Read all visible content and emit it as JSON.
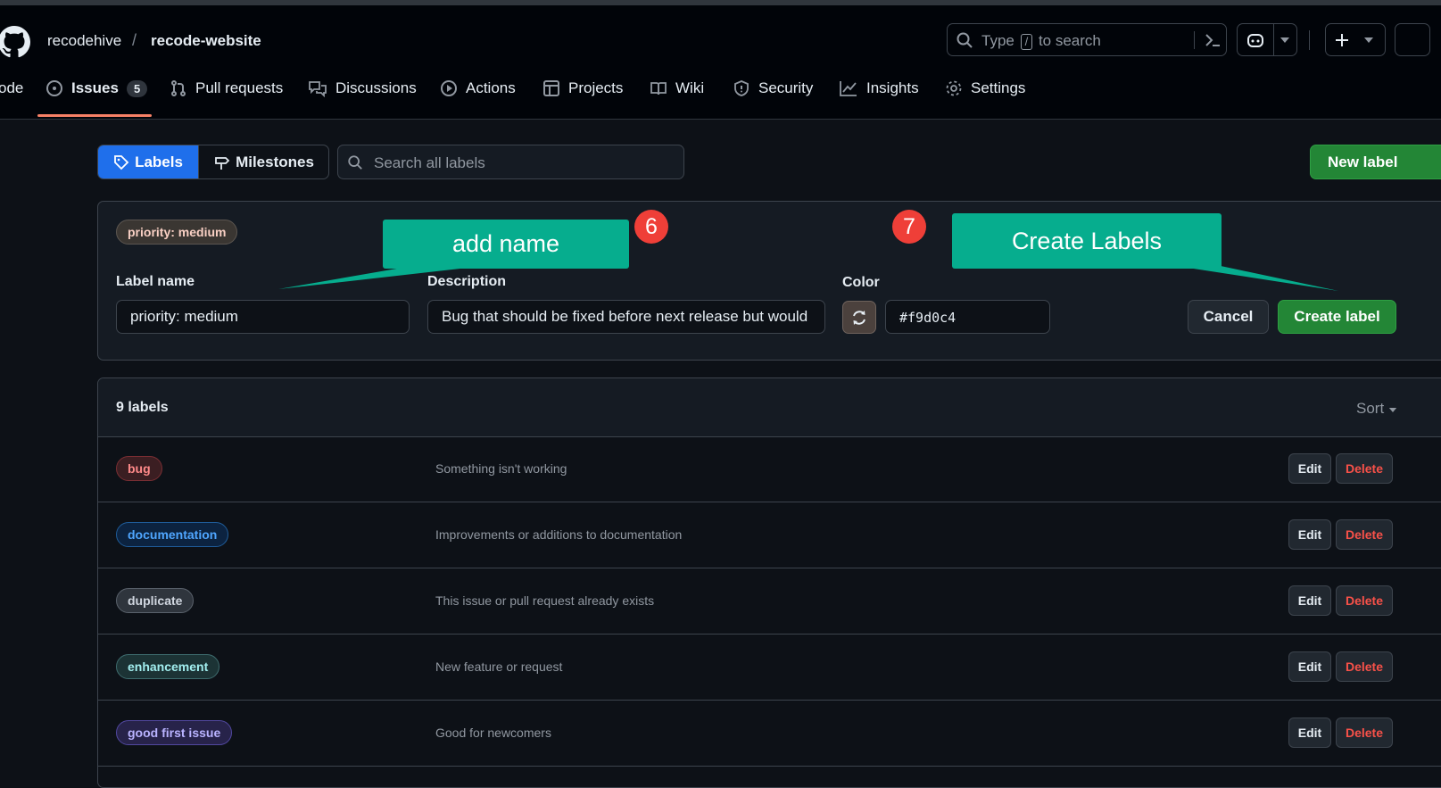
{
  "repo": {
    "owner": "recodehive",
    "slash": "/",
    "name": "recode-website"
  },
  "search": {
    "prefix": "Type",
    "key": "/",
    "suffix": "to search"
  },
  "tabs": [
    {
      "label": "ode",
      "icon": "code-icon"
    },
    {
      "label": "Issues",
      "icon": "issue-opened-icon",
      "count": "5",
      "active": true
    },
    {
      "label": "Pull requests",
      "icon": "git-pull-request-icon"
    },
    {
      "label": "Discussions",
      "icon": "comment-discussion-icon"
    },
    {
      "label": "Actions",
      "icon": "play-icon"
    },
    {
      "label": "Projects",
      "icon": "table-icon"
    },
    {
      "label": "Wiki",
      "icon": "book-icon"
    },
    {
      "label": "Security",
      "icon": "shield-icon"
    },
    {
      "label": "Insights",
      "icon": "graph-icon"
    },
    {
      "label": "Settings",
      "icon": "gear-icon"
    }
  ],
  "subnav": {
    "labels": "Labels",
    "milestones": "Milestones",
    "search_placeholder": "Search all labels",
    "new_label": "New label"
  },
  "form": {
    "preview": "priority: medium",
    "name_label": "Label name",
    "name_value": "priority: medium",
    "desc_label": "Description",
    "desc_value": "Bug that should be fixed before next release but would",
    "color_label": "Color",
    "color_value": "#f9d0c4",
    "cancel": "Cancel",
    "create": "Create label"
  },
  "annotations": {
    "callout1": "add name",
    "badge1": "6",
    "callout2": "Create Labels",
    "badge2": "7"
  },
  "list": {
    "count": "9 labels",
    "sort": "Sort",
    "edit": "Edit",
    "delete": "Delete",
    "rows": [
      {
        "name": "bug",
        "desc": "Something isn't working",
        "fg": "#ff8a8a",
        "bg": "#3b1e22",
        "border": "#7a2e33"
      },
      {
        "name": "documentation",
        "desc": "Improvements or additions to documentation",
        "fg": "#4fa6ff",
        "bg": "#0c2340",
        "border": "#1f5c99"
      },
      {
        "name": "duplicate",
        "desc": "This issue or pull request already exists",
        "fg": "#d1d7e0",
        "bg": "#2f353d",
        "border": "#5a626c"
      },
      {
        "name": "enhancement",
        "desc": "New feature or request",
        "fg": "#a2eeef",
        "bg": "#1c3335",
        "border": "#3e6c6e"
      },
      {
        "name": "good first issue",
        "desc": "Good for newcomers",
        "fg": "#b9b3ff",
        "bg": "#27234a",
        "border": "#5148a0"
      }
    ]
  }
}
